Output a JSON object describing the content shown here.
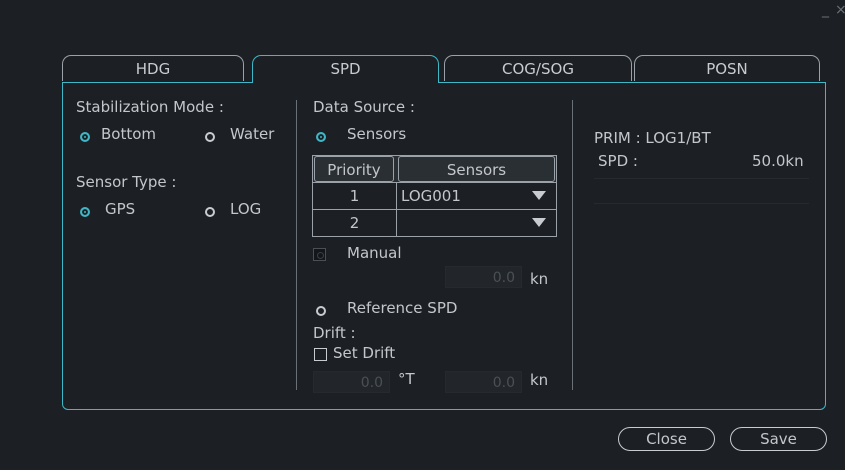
{
  "window": {
    "minimize_glyph": "_",
    "close_glyph": "×"
  },
  "tabs": [
    {
      "label": "HDG",
      "active": false
    },
    {
      "label": "SPD",
      "active": true
    },
    {
      "label": "COG/SOG",
      "active": false
    },
    {
      "label": "POSN",
      "active": false
    }
  ],
  "stabilization": {
    "title": "Stabilization Mode :",
    "options": [
      {
        "label": "Bottom",
        "selected": true
      },
      {
        "label": "Water",
        "selected": false
      }
    ]
  },
  "sensor_type": {
    "title": "Sensor Type :",
    "options": [
      {
        "label": "GPS",
        "selected": true
      },
      {
        "label": "LOG",
        "selected": false
      }
    ]
  },
  "data_source": {
    "title": "Data Source :",
    "sensors_label": "Sensors",
    "sensors_selected": true,
    "table": {
      "headers": [
        "Priority",
        "Sensors"
      ],
      "rows": [
        {
          "priority": "1",
          "sensor": "LOG001"
        },
        {
          "priority": "2",
          "sensor": ""
        }
      ]
    },
    "manual_label": "Manual",
    "manual_value": "0.0",
    "manual_unit": "kn",
    "reference_label": "Reference SPD",
    "drift_title": "Drift :",
    "set_drift_label": "Set Drift",
    "drift_set_value": "0.0",
    "drift_set_unit": "°T",
    "drift_speed_value": "0.0",
    "drift_speed_unit": "kn"
  },
  "primary": {
    "prim_label": "PRIM : LOG1/BT",
    "spd_label": "SPD :",
    "spd_value": "50.0kn"
  },
  "buttons": {
    "close": "Close",
    "save": "Save"
  },
  "colors": {
    "accent": "#3fb7c6",
    "background": "#1c2024",
    "text": "#c3c7cc"
  }
}
